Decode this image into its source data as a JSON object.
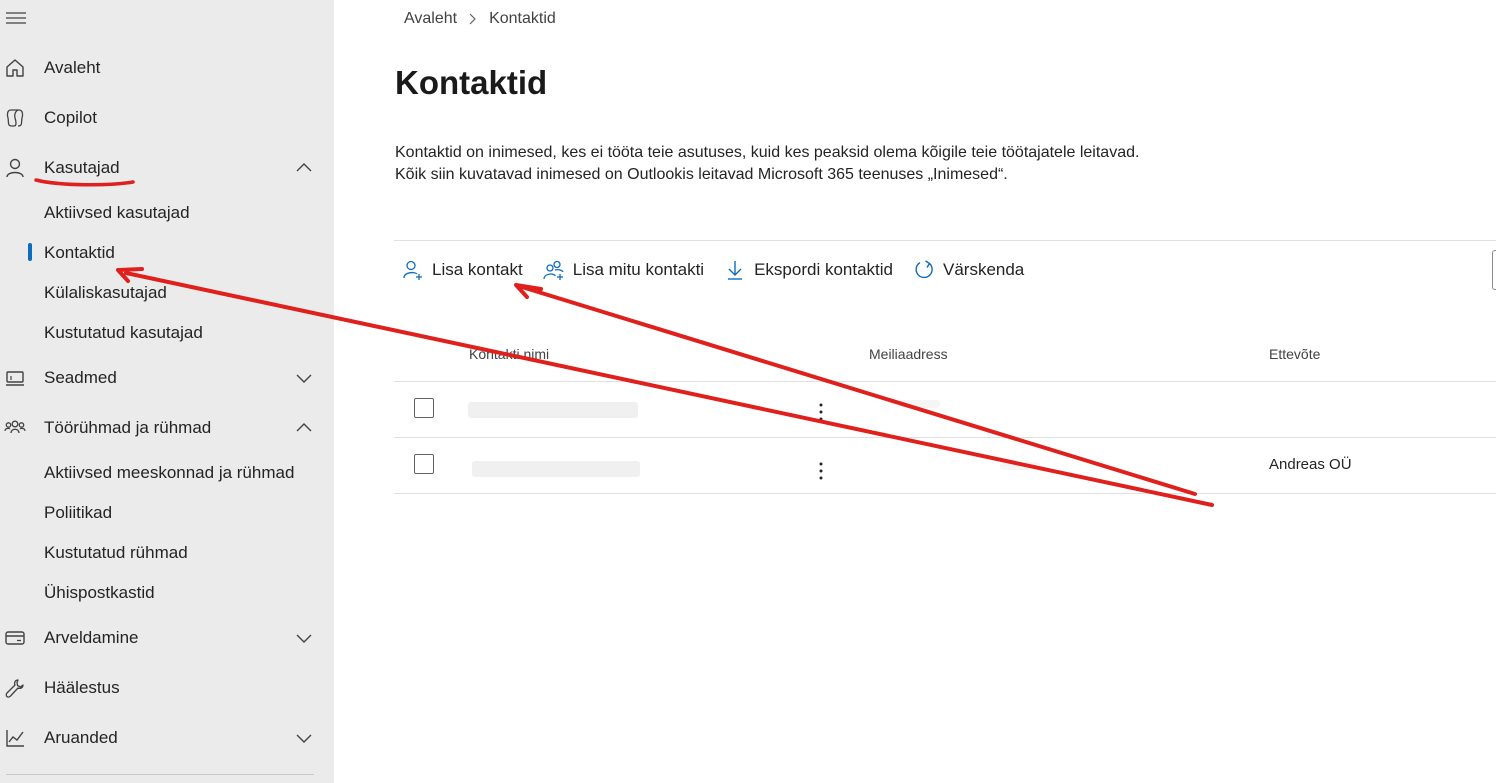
{
  "sidebar": {
    "items": [
      {
        "label": "Avaleht",
        "icon": "home-icon"
      },
      {
        "label": "Copilot",
        "icon": "copilot-icon"
      },
      {
        "label": "Kasutajad",
        "icon": "person-icon",
        "expanded": true,
        "children": [
          "Aktiivsed kasutajad",
          "Kontaktid",
          "Külaliskasutajad",
          "Kustutatud kasutajad"
        ]
      },
      {
        "label": "Seadmed",
        "icon": "device-icon",
        "expanded": false
      },
      {
        "label": "Töörühmad ja rühmad",
        "icon": "people-team-icon",
        "expanded": true,
        "children": [
          "Aktiivsed meeskonnad ja rühmad",
          "Poliitikad",
          "Kustutatud rühmad",
          "Ühispostkastid"
        ]
      },
      {
        "label": "Arveldamine",
        "icon": "credit-card-icon",
        "expanded": false
      },
      {
        "label": "Häälestus",
        "icon": "wrench-icon"
      },
      {
        "label": "Aruanded",
        "icon": "chart-line-icon",
        "expanded": false
      }
    ],
    "active_child": "Kontaktid"
  },
  "breadcrumb": {
    "home": "Avaleht",
    "current": "Kontaktid"
  },
  "page": {
    "title": "Kontaktid",
    "description": "Kontaktid on inimesed, kes ei tööta teie asutuses, kuid kes peaksid olema kõigile teie töötajatele leitavad. Kõik siin kuvatavad inimesed on Outlookis leitavad Microsoft 365 teenuses „Inimesed“."
  },
  "toolbar": {
    "add_contact": "Lisa kontakt",
    "add_multiple": "Lisa mitu kontakti",
    "export": "Ekspordi kontaktid",
    "refresh": "Värskenda"
  },
  "table": {
    "columns": [
      "Kontakti nimi",
      "Meiliaadress",
      "Ettevõte"
    ],
    "rows": [
      {
        "name": "",
        "email": "",
        "company": ""
      },
      {
        "name": "",
        "email": "",
        "company": "Andreas OÜ"
      }
    ]
  },
  "colors": {
    "accent": "#0f6cbd",
    "annotation": "#e0201c",
    "sidebar_bg": "#ebebeb"
  }
}
